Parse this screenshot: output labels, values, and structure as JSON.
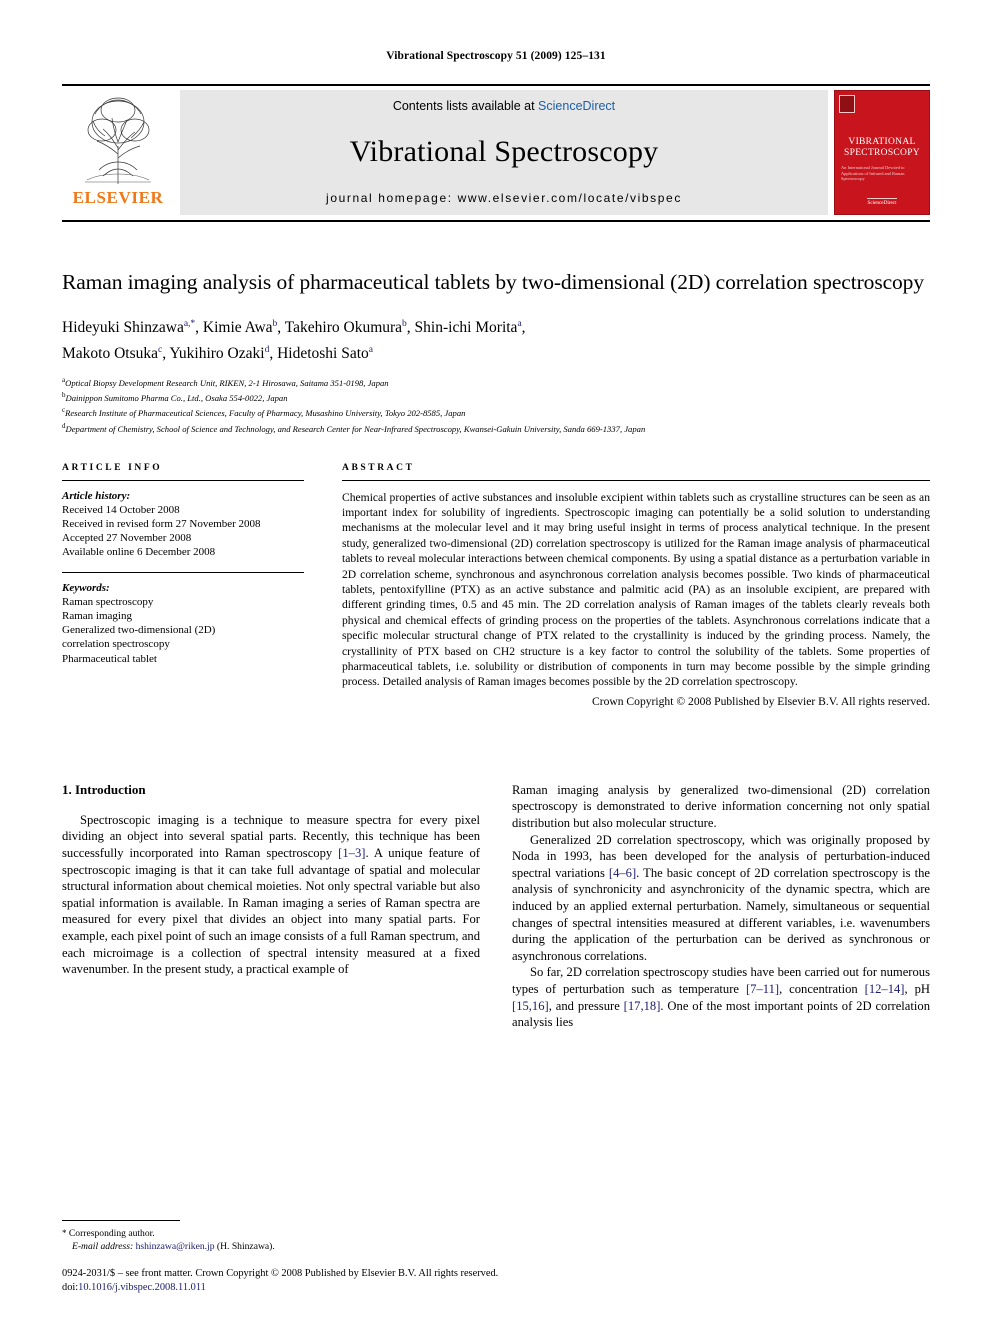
{
  "running_head": "Vibrational Spectroscopy 51 (2009) 125–131",
  "masthead": {
    "publisher_name": "ELSEVIER",
    "contents_prefix": "Contents lists available at",
    "sciencedirect": "ScienceDirect",
    "journal_name": "Vibrational Spectroscopy",
    "homepage": "journal homepage: www.elsevier.com/locate/vibspec",
    "cover": {
      "title_line1": "VIBRATIONAL",
      "title_line2": "SPECTROSCOPY",
      "subtitle": "An International Journal Devoted to Applications of Infrared and Raman Spectroscopy",
      "footer": "ScienceDirect",
      "color": "#c8141c"
    }
  },
  "article": {
    "title": "Raman imaging analysis of pharmaceutical tablets by two-dimensional (2D) correlation spectroscopy",
    "authors_line1": "Hideyuki Shinzawa",
    "authors": [
      {
        "name": "Hideyuki Shinzawa",
        "marks": "a,*"
      },
      {
        "name": "Kimie Awa",
        "marks": "b"
      },
      {
        "name": "Takehiro Okumura",
        "marks": "b"
      },
      {
        "name": "Shin-ichi Morita",
        "marks": "a"
      },
      {
        "name": "Makoto Otsuka",
        "marks": "c"
      },
      {
        "name": "Yukihiro Ozaki",
        "marks": "d"
      },
      {
        "name": "Hidetoshi Sato",
        "marks": "a"
      }
    ],
    "affiliations": [
      {
        "mark": "a",
        "text": "Optical Biopsy Development Research Unit, RIKEN, 2-1 Hirosawa, Saitama 351-0198, Japan"
      },
      {
        "mark": "b",
        "text": "Dainippon Sumitomo Pharma Co., Ltd., Osaka 554-0022, Japan"
      },
      {
        "mark": "c",
        "text": "Research Institute of Pharmaceutical Sciences, Faculty of Pharmacy, Musashino University, Tokyo 202-8585, Japan"
      },
      {
        "mark": "d",
        "text": "Department of Chemistry, School of Science and Technology, and Research Center for Near-Infrared Spectroscopy, Kwansei-Gakuin University, Sanda 669-1337, Japan"
      }
    ]
  },
  "article_info": {
    "label": "ARTICLE INFO",
    "history_label": "Article history:",
    "history": [
      "Received 14 October 2008",
      "Received in revised form 27 November 2008",
      "Accepted 27 November 2008",
      "Available online 6 December 2008"
    ],
    "keywords_label": "Keywords:",
    "keywords": [
      "Raman spectroscopy",
      "Raman imaging",
      "Generalized two-dimensional (2D)",
      "correlation spectroscopy",
      "Pharmaceutical tablet"
    ]
  },
  "abstract": {
    "label": "ABSTRACT",
    "text": "Chemical properties of active substances and insoluble excipient within tablets such as crystalline structures can be seen as an important index for solubility of ingredients. Spectroscopic imaging can potentially be a solid solution to understanding mechanisms at the molecular level and it may bring useful insight in terms of process analytical technique. In the present study, generalized two-dimensional (2D) correlation spectroscopy is utilized for the Raman image analysis of pharmaceutical tablets to reveal molecular interactions between chemical components. By using a spatial distance as a perturbation variable in 2D correlation scheme, synchronous and asynchronous correlation analysis becomes possible. Two kinds of pharmaceutical tablets, pentoxifylline (PTX) as an active substance and palmitic acid (PA) as an insoluble excipient, are prepared with different grinding times, 0.5 and 45 min. The 2D correlation analysis of Raman images of the tablets clearly reveals both physical and chemical effects of grinding process on the properties of the tablets. Asynchronous correlations indicate that a specific molecular structural change of PTX related to the crystallinity is induced by the grinding process. Namely, the crystallinity of PTX based on CH2 structure is a key factor to control the solubility of the tablets. Some properties of pharmaceutical tablets, i.e. solubility or distribution of components in turn may become possible by the simple grinding process. Detailed analysis of Raman images becomes possible by the 2D correlation spectroscopy.",
    "copyright": "Crown Copyright © 2008 Published by Elsevier B.V. All rights reserved."
  },
  "introduction": {
    "heading": "1. Introduction",
    "left_para_1_a": "Spectroscopic imaging is a technique to measure spectra for every pixel dividing an object into several spatial parts. Recently, this technique has been successfully incorporated into Raman spectroscopy ",
    "left_cite_1": "[1–3]",
    "left_para_1_b": ". A unique feature of spectroscopic imaging is that it can take full advantage of spatial and molecular structural information about chemical moieties. Not only spectral variable but also spatial information is available. In Raman imaging a series of Raman spectra are measured for every pixel that divides an object into many spatial parts. For example, each pixel point of such an image consists of a full Raman spectrum, and each microimage is a collection of spectral intensity measured at a fixed wavenumber. In the present study, a practical example of",
    "right_para_1": "Raman imaging analysis by generalized two-dimensional (2D) correlation spectroscopy is demonstrated to derive information concerning not only spatial distribution but also molecular structure.",
    "right_para_2_a": "Generalized 2D correlation spectroscopy, which was originally proposed by Noda in 1993, has been developed for the analysis of perturbation-induced spectral variations ",
    "right_cite_2": "[4–6]",
    "right_para_2_b": ". The basic concept of 2D correlation spectroscopy is the analysis of synchronicity and asynchronicity of the dynamic spectra, which are induced by an applied external perturbation. Namely, simultaneous or sequential changes of spectral intensities measured at different variables, i.e. wavenumbers during the application of the perturbation can be derived as synchronous or asynchronous correlations.",
    "right_para_3_a": "So far, 2D correlation spectroscopy studies have been carried out for numerous types of perturbation such as temperature ",
    "right_cite_3a": "[7–11]",
    "right_para_3_b": ", concentration ",
    "right_cite_3b": "[12–14]",
    "right_para_3_c": ", pH ",
    "right_cite_3c": "[15,16]",
    "right_para_3_d": ", and pressure ",
    "right_cite_3d": "[17,18]",
    "right_para_3_e": ". One of the most important points of 2D correlation analysis lies"
  },
  "footnote": {
    "mark": "*",
    "corresponding": "Corresponding author.",
    "email_label": "E-mail address:",
    "email": "hshinzawa@riken.jp",
    "email_owner": "(H. Shinzawa)."
  },
  "footer": {
    "line1": "0924-2031/$ – see front matter. Crown Copyright © 2008 Published by Elsevier B.V. All rights reserved.",
    "doi_label": "doi:",
    "doi": "10.1016/j.vibspec.2008.11.011"
  }
}
